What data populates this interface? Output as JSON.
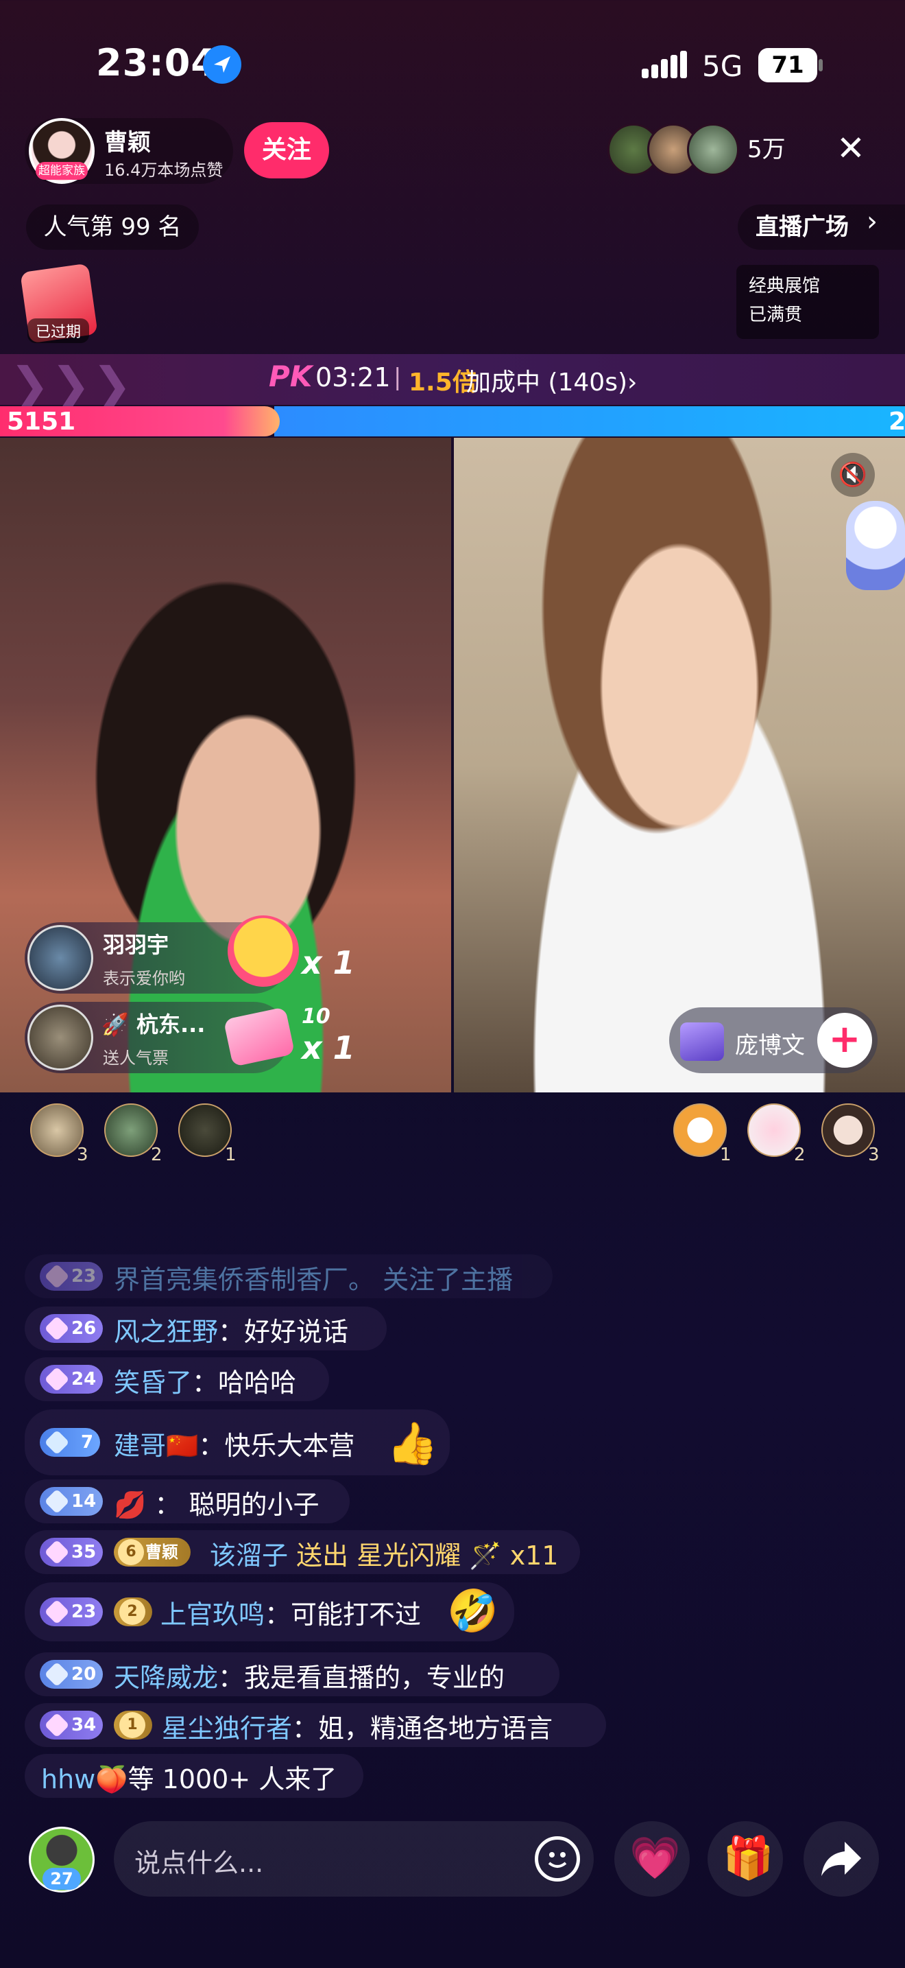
{
  "status_bar": {
    "time": "23:04",
    "network": "5G",
    "battery": "71"
  },
  "host": {
    "name": "曹颖",
    "likes": "16.4万本场点赞",
    "badge": "超能家族",
    "follow_label": "关注"
  },
  "viewers": {
    "count": "5万"
  },
  "rank": "人气第 99 名",
  "plaza": "直播广场",
  "redpack": {
    "label": "已过期"
  },
  "expo": {
    "line1": "经典展馆",
    "line2": "已满贯"
  },
  "pk": {
    "logo": "PK",
    "timer": "03:21",
    "separator": "|",
    "multiplier": "1.5倍",
    "status": "加成中 (140s)",
    "arrow": "›"
  },
  "score": {
    "left": "5151",
    "right": "2"
  },
  "gifts": [
    {
      "name": "羽羽宇",
      "sub": "表示爱你哟",
      "count": "x 1"
    },
    {
      "name": "🚀 杭东...",
      "sub": "送人气票",
      "count": "x 1",
      "combo": "10"
    }
  ],
  "anchor": {
    "name": "庞博文"
  },
  "top_gifters_left": [
    "3",
    "2",
    "1"
  ],
  "top_gifters_right": [
    "1",
    "2",
    "3"
  ],
  "chat": [
    {
      "level": "23",
      "user": "界首亮集侨香制香厂。",
      "msg": " 关注了主播",
      "faded": true
    },
    {
      "level": "26",
      "user": "风之狂野",
      "msg": "好好说话"
    },
    {
      "level": "24",
      "user": "笑昏了",
      "msg": "哈哈哈"
    },
    {
      "level": "7",
      "user": "建哥🇨🇳",
      "msg": "快乐大本营"
    },
    {
      "level": "14",
      "user": "💋",
      "msg": "聪明的小子"
    },
    {
      "level": "35",
      "fan": "曹颖",
      "fan_level": "6",
      "user": "该溜子",
      "gift": "送出 星光闪耀",
      "gift_count": "x11"
    },
    {
      "level": "23",
      "fan_level": "2",
      "user": "上官玖鸣",
      "msg": "可能打不过"
    },
    {
      "level": "20",
      "user": "天降威龙",
      "msg": "我是看直播的，专业的"
    },
    {
      "level": "34",
      "fan_level": "1",
      "user": "星尘独行者",
      "msg": "姐，精通各地方语言"
    }
  ],
  "join": {
    "user": "hhw🍑",
    "text": "等 1000+ 人来了"
  },
  "bottom": {
    "placeholder": "说点什么...",
    "my_level": "27"
  }
}
